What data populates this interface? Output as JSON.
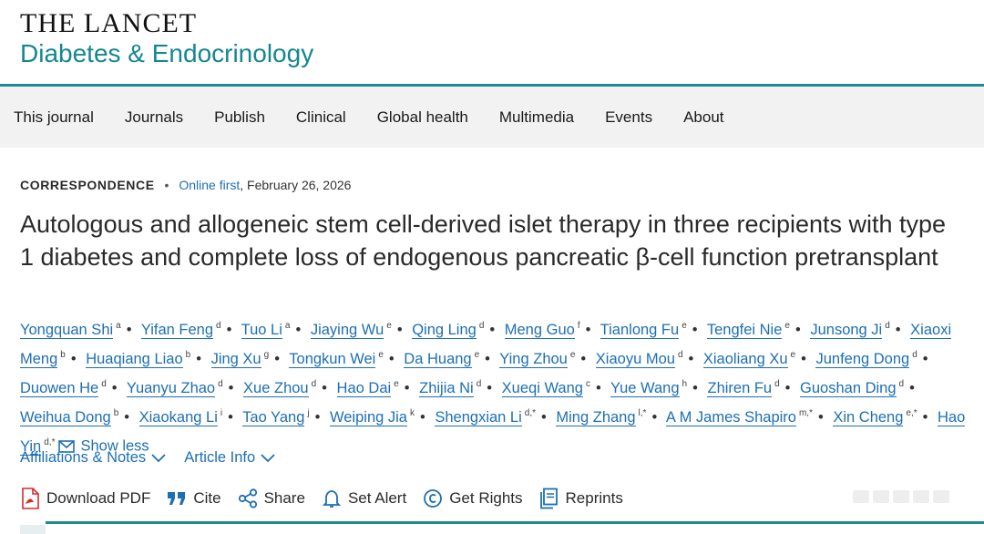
{
  "brand": {
    "line1": "THE LANCET",
    "line2": "Diabetes & Endocrinology"
  },
  "nav": {
    "items": [
      "This journal",
      "Journals",
      "Publish",
      "Clinical",
      "Global health",
      "Multimedia",
      "Events",
      "About"
    ]
  },
  "meta": {
    "type": "CORRESPONDENCE",
    "dot": "•",
    "online": "Online first",
    "date": ", February 26, 2026"
  },
  "title": "Autologous and allogeneic stem cell-derived islet therapy in three recipients with type 1 diabetes and complete loss of endogenous pancreatic β-cell function pretransplant",
  "authors": [
    {
      "name": "Yongquan Shi",
      "sup": "a"
    },
    {
      "name": "Yifan Feng",
      "sup": "d"
    },
    {
      "name": "Tuo Li",
      "sup": "a"
    },
    {
      "name": "Jiaying Wu",
      "sup": "e"
    },
    {
      "name": "Qing Ling",
      "sup": "d"
    },
    {
      "name": "Meng Guo",
      "sup": "f"
    },
    {
      "name": "Tianlong Fu",
      "sup": "e"
    },
    {
      "name": "Tengfei Nie",
      "sup": "e"
    },
    {
      "name": "Junsong Ji",
      "sup": "d"
    },
    {
      "name": "Xiaoxi Meng",
      "sup": "b"
    },
    {
      "name": "Huaqiang Liao",
      "sup": "b"
    },
    {
      "name": "Jing Xu",
      "sup": "g"
    },
    {
      "name": "Tongkun Wei",
      "sup": "e"
    },
    {
      "name": "Da Huang",
      "sup": "e"
    },
    {
      "name": "Ying Zhou",
      "sup": "e"
    },
    {
      "name": "Xiaoyu Mou",
      "sup": "d"
    },
    {
      "name": "Xiaoliang Xu",
      "sup": "e"
    },
    {
      "name": "Junfeng Dong",
      "sup": "d"
    },
    {
      "name": "Duowen He",
      "sup": "d"
    },
    {
      "name": "Yuanyu Zhao",
      "sup": "d"
    },
    {
      "name": "Xue Zhou",
      "sup": "d"
    },
    {
      "name": "Hao Dai",
      "sup": "e"
    },
    {
      "name": "Zhijia Ni",
      "sup": "d"
    },
    {
      "name": "Xueqi Wang",
      "sup": "c"
    },
    {
      "name": "Yue Wang",
      "sup": "h"
    },
    {
      "name": "Zhiren Fu",
      "sup": "d"
    },
    {
      "name": "Guoshan Ding",
      "sup": "d"
    },
    {
      "name": "Weihua Dong",
      "sup": "b"
    },
    {
      "name": "Xiaokang Li",
      "sup": "i"
    },
    {
      "name": "Tao Yang",
      "sup": "j"
    },
    {
      "name": "Weiping Jia",
      "sup": "k"
    },
    {
      "name": "Shengxian Li",
      "sup": "d,*"
    },
    {
      "name": "Ming Zhang",
      "sup": "l,*"
    },
    {
      "name": "A M James Shapiro",
      "sup": "m,*"
    },
    {
      "name": "Xin Cheng",
      "sup": "e,*"
    },
    {
      "name": "Hao Yin",
      "sup": "d,*"
    }
  ],
  "show_less": "Show less",
  "more": {
    "affiliations": "Affiliations & Notes",
    "article_info": "Article Info"
  },
  "tools": {
    "download": "Download PDF",
    "cite": "Cite",
    "share": "Share",
    "alert": "Set Alert",
    "rights": "Get Rights",
    "reprints": "Reprints"
  },
  "colors": {
    "accent": "#1f8a93",
    "link": "#1d6fb3",
    "pdf_red": "#d62b2b"
  }
}
